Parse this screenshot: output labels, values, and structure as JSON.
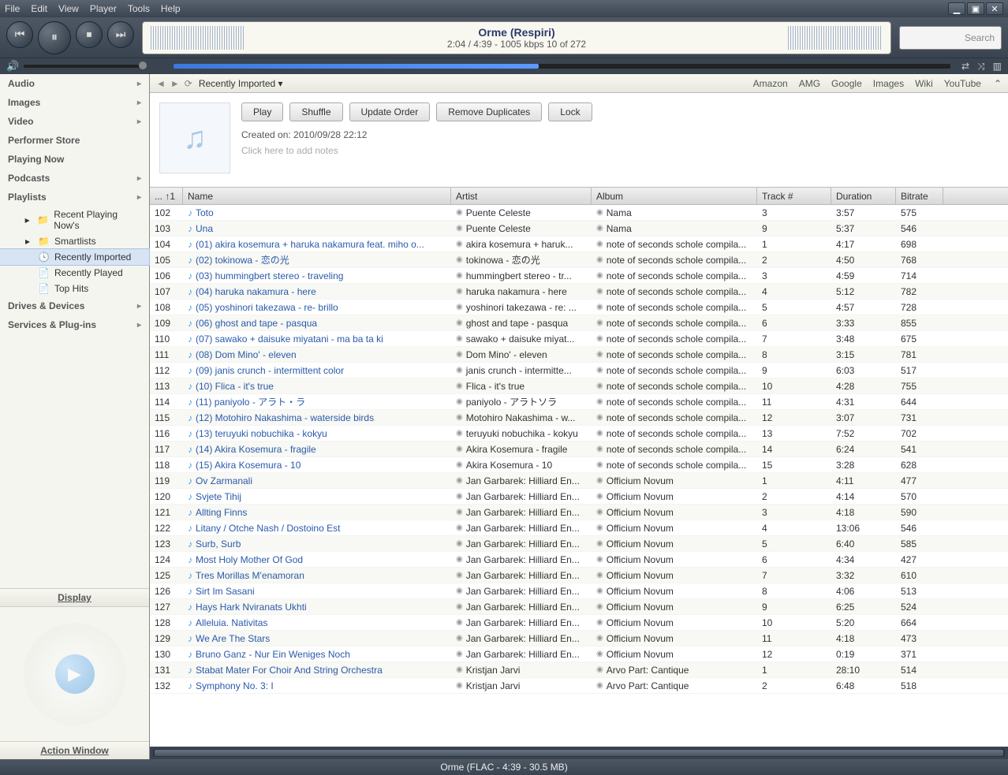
{
  "menu": [
    "File",
    "Edit",
    "View",
    "Player",
    "Tools",
    "Help"
  ],
  "nowplay": {
    "title": "Orme (Respiri)",
    "sub": "2:04 / 4:39 - 1005 kbps   10 of 272"
  },
  "search_placeholder": "Search",
  "side_main": [
    {
      "label": "Audio",
      "chev": true
    },
    {
      "label": "Images",
      "chev": true
    },
    {
      "label": "Video",
      "chev": true
    },
    {
      "label": "Performer Store",
      "chev": false
    },
    {
      "label": "Playing Now",
      "chev": false
    },
    {
      "label": "Podcasts",
      "chev": true
    },
    {
      "label": "Playlists",
      "chev": true
    }
  ],
  "side_subs": [
    {
      "icon": "▸",
      "folder": "📁",
      "label": "Recent Playing Now's"
    },
    {
      "icon": "▸",
      "folder": "📁",
      "label": "Smartlists"
    },
    {
      "icon": "",
      "folder": "🕓",
      "label": "Recently Imported",
      "selected": true
    },
    {
      "icon": "",
      "folder": "📄",
      "label": "Recently Played"
    },
    {
      "icon": "",
      "folder": "📄",
      "label": "Top Hits"
    }
  ],
  "side_lower": [
    {
      "label": "Drives & Devices",
      "chev": true
    },
    {
      "label": "Services & Plug-ins",
      "chev": true
    }
  ],
  "display_btn": "Display",
  "action_btn": "Action Window",
  "crumb": "Recently Imported ▾",
  "web_links": [
    "Amazon",
    "AMG",
    "Google",
    "Images",
    "Wiki",
    "YouTube"
  ],
  "buttons": [
    "Play",
    "Shuffle",
    "Update Order",
    "Remove Duplicates",
    "Lock"
  ],
  "created": "Created on: 2010/09/28 22:12",
  "notes": "Click here to add notes",
  "headers": {
    "num": "... ↑1",
    "name": "Name",
    "artist": "Artist",
    "album": "Album",
    "track": "Track #",
    "dur": "Duration",
    "bit": "Bitrate"
  },
  "tracks": [
    {
      "n": "102",
      "name": "Toto",
      "artist": "Puente Celeste",
      "album": "Nama",
      "t": "3",
      "d": "3:57",
      "b": "575"
    },
    {
      "n": "103",
      "name": "Una",
      "artist": "Puente Celeste",
      "album": "Nama",
      "t": "9",
      "d": "5:37",
      "b": "546"
    },
    {
      "n": "104",
      "name": "(01) akira kosemura + haruka nakamura feat. miho o...",
      "artist": "akira kosemura + haruk...",
      "album": "note of seconds schole compila...",
      "t": "1",
      "d": "4:17",
      "b": "698"
    },
    {
      "n": "105",
      "name": "(02) tokinowa - 恋の光",
      "artist": "tokinowa - 恋の光",
      "album": "note of seconds schole compila...",
      "t": "2",
      "d": "4:50",
      "b": "768"
    },
    {
      "n": "106",
      "name": "(03) hummingbert stereo - traveling",
      "artist": "hummingbert stereo - tr...",
      "album": "note of seconds schole compila...",
      "t": "3",
      "d": "4:59",
      "b": "714"
    },
    {
      "n": "107",
      "name": "(04) haruka nakamura - here",
      "artist": "haruka nakamura - here",
      "album": "note of seconds schole compila...",
      "t": "4",
      "d": "5:12",
      "b": "782"
    },
    {
      "n": "108",
      "name": "(05) yoshinori takezawa - re- brillo",
      "artist": "yoshinori takezawa - re: ...",
      "album": "note of seconds schole compila...",
      "t": "5",
      "d": "4:57",
      "b": "728"
    },
    {
      "n": "109",
      "name": "(06) ghost and tape - pasqua",
      "artist": "ghost and tape - pasqua",
      "album": "note of seconds schole compila...",
      "t": "6",
      "d": "3:33",
      "b": "855"
    },
    {
      "n": "110",
      "name": "(07) sawako + daisuke miyatani - ma ba ta ki",
      "artist": "sawako + daisuke miyat...",
      "album": "note of seconds schole compila...",
      "t": "7",
      "d": "3:48",
      "b": "675"
    },
    {
      "n": "111",
      "name": "(08) Dom Mino' - eleven",
      "artist": "Dom Mino' - eleven",
      "album": "note of seconds schole compila...",
      "t": "8",
      "d": "3:15",
      "b": "781"
    },
    {
      "n": "112",
      "name": "(09) janis crunch - intermittent color",
      "artist": "janis crunch - intermitte...",
      "album": "note of seconds schole compila...",
      "t": "9",
      "d": "6:03",
      "b": "517"
    },
    {
      "n": "113",
      "name": "(10) Flica - it's true",
      "artist": "Flica - it's true",
      "album": "note of seconds schole compila...",
      "t": "10",
      "d": "4:28",
      "b": "755"
    },
    {
      "n": "114",
      "name": "(11) paniyolo - アラト・ラ",
      "artist": "paniyolo - アラトソラ",
      "album": "note of seconds schole compila...",
      "t": "11",
      "d": "4:31",
      "b": "644"
    },
    {
      "n": "115",
      "name": "(12) Motohiro Nakashima - waterside birds",
      "artist": "Motohiro Nakashima - w...",
      "album": "note of seconds schole compila...",
      "t": "12",
      "d": "3:07",
      "b": "731"
    },
    {
      "n": "116",
      "name": "(13) teruyuki nobuchika - kokyu",
      "artist": "teruyuki nobuchika - kokyu",
      "album": "note of seconds schole compila...",
      "t": "13",
      "d": "7:52",
      "b": "702"
    },
    {
      "n": "117",
      "name": "(14) Akira Kosemura - fragile",
      "artist": "Akira Kosemura - fragile",
      "album": "note of seconds schole compila...",
      "t": "14",
      "d": "6:24",
      "b": "541"
    },
    {
      "n": "118",
      "name": "(15) Akira Kosemura - 10",
      "artist": "Akira Kosemura - 10",
      "album": "note of seconds schole compila...",
      "t": "15",
      "d": "3:28",
      "b": "628"
    },
    {
      "n": "119",
      "name": "Ov Zarmanali",
      "artist": "Jan Garbarek: Hilliard En...",
      "album": "Officium Novum",
      "t": "1",
      "d": "4:11",
      "b": "477"
    },
    {
      "n": "120",
      "name": "Svjete Tihij",
      "artist": "Jan Garbarek: Hilliard En...",
      "album": "Officium Novum",
      "t": "2",
      "d": "4:14",
      "b": "570"
    },
    {
      "n": "121",
      "name": "Allting Finns",
      "artist": "Jan Garbarek: Hilliard En...",
      "album": "Officium Novum",
      "t": "3",
      "d": "4:18",
      "b": "590"
    },
    {
      "n": "122",
      "name": "Litany / Otche Nash / Dostoino Est",
      "artist": "Jan Garbarek: Hilliard En...",
      "album": "Officium Novum",
      "t": "4",
      "d": "13:06",
      "b": "546"
    },
    {
      "n": "123",
      "name": "Surb, Surb",
      "artist": "Jan Garbarek: Hilliard En...",
      "album": "Officium Novum",
      "t": "5",
      "d": "6:40",
      "b": "585"
    },
    {
      "n": "124",
      "name": "Most Holy Mother Of God",
      "artist": "Jan Garbarek: Hilliard En...",
      "album": "Officium Novum",
      "t": "6",
      "d": "4:34",
      "b": "427"
    },
    {
      "n": "125",
      "name": "Tres Morillas M'enamoran",
      "artist": "Jan Garbarek: Hilliard En...",
      "album": "Officium Novum",
      "t": "7",
      "d": "3:32",
      "b": "610"
    },
    {
      "n": "126",
      "name": "Sirt Im Sasani",
      "artist": "Jan Garbarek: Hilliard En...",
      "album": "Officium Novum",
      "t": "8",
      "d": "4:06",
      "b": "513"
    },
    {
      "n": "127",
      "name": "Hays Hark Nviranats Ukhti",
      "artist": "Jan Garbarek: Hilliard En...",
      "album": "Officium Novum",
      "t": "9",
      "d": "6:25",
      "b": "524"
    },
    {
      "n": "128",
      "name": "Alleluia. Nativitas",
      "artist": "Jan Garbarek: Hilliard En...",
      "album": "Officium Novum",
      "t": "10",
      "d": "5:20",
      "b": "664"
    },
    {
      "n": "129",
      "name": "We Are The Stars",
      "artist": "Jan Garbarek: Hilliard En...",
      "album": "Officium Novum",
      "t": "11",
      "d": "4:18",
      "b": "473"
    },
    {
      "n": "130",
      "name": "Bruno Ganz - Nur Ein Weniges Noch",
      "artist": "Jan Garbarek: Hilliard En...",
      "album": "Officium Novum",
      "t": "12",
      "d": "0:19",
      "b": "371"
    },
    {
      "n": "131",
      "name": "Stabat Mater For Choir And String Orchestra",
      "artist": "Kristjan Jarvi",
      "album": "Arvo Part: Cantique",
      "t": "1",
      "d": "28:10",
      "b": "514"
    },
    {
      "n": "132",
      "name": "Symphony No. 3: I",
      "artist": "Kristjan Jarvi",
      "album": "Arvo Part: Cantique",
      "t": "2",
      "d": "6:48",
      "b": "518"
    }
  ],
  "status": "Orme (FLAC - 4:39 - 30.5 MB)"
}
